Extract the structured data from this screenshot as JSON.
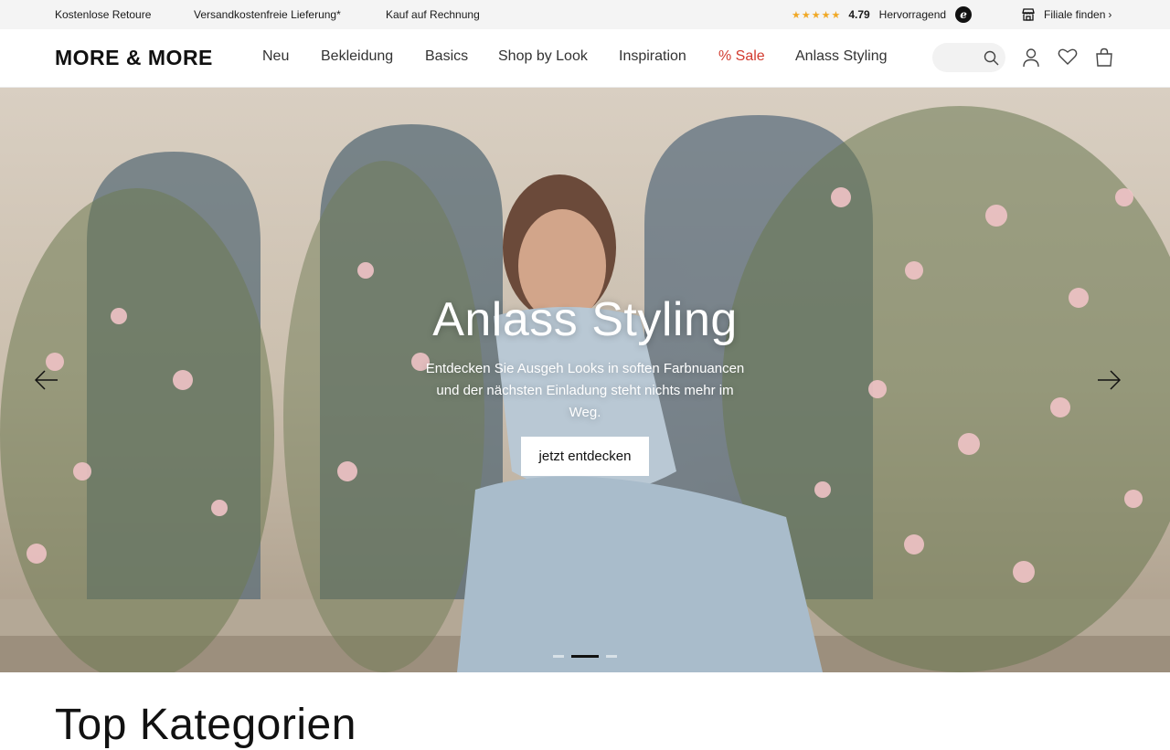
{
  "topbar": {
    "usps": [
      "Kostenlose Retoure",
      "Versandkostenfreie Lieferung*",
      "Kauf auf Rechnung"
    ],
    "rating": {
      "stars": "★★★★★",
      "value": "4.79",
      "label": "Hervorragend",
      "badge": "e"
    },
    "store_finder": {
      "label": "Filiale finden",
      "chevron": "›"
    }
  },
  "header": {
    "logo": "MORE & MORE",
    "nav": [
      "Neu",
      "Bekleidung",
      "Basics",
      "Shop by Look",
      "Inspiration",
      "% Sale",
      "Anlass Styling"
    ],
    "search": {
      "placeholder": ""
    },
    "icons": [
      "search-icon",
      "account-icon",
      "wishlist-icon",
      "cart-icon"
    ]
  },
  "hero": {
    "title": "Anlass Styling",
    "text": "Entdecken Sie Ausgeh Looks in soften Farbnuancen und der nächsten Einladung steht nichts mehr im Weg.",
    "cta": "jetzt entdecken",
    "active_slide": 2,
    "slide_count": 3
  },
  "section": {
    "title": "Top Kategorien"
  },
  "colors": {
    "sale": "#d23b2f",
    "rating_star": "#f0a826",
    "topbar_bg": "#f4f4f4"
  }
}
